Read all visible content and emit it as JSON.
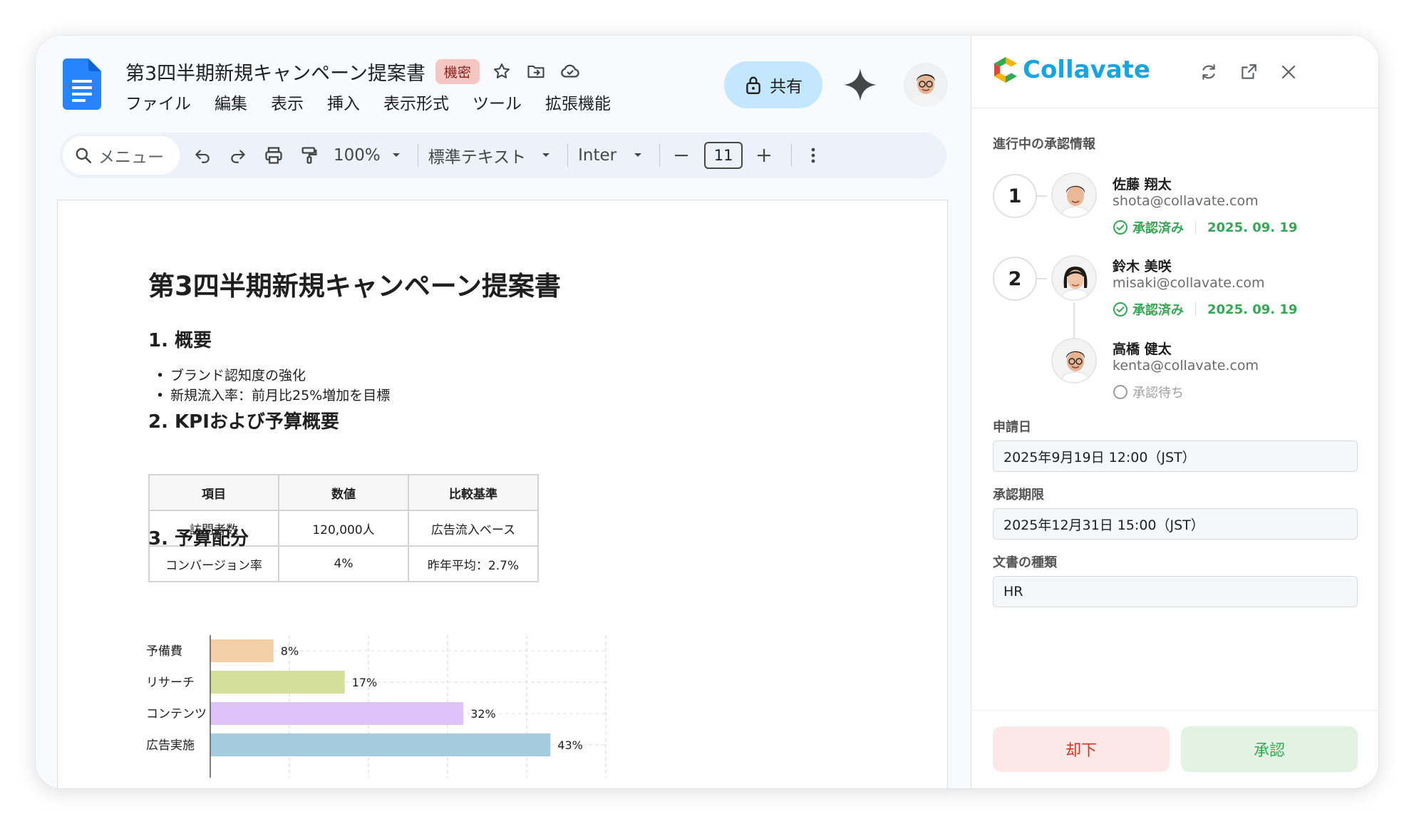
{
  "docs": {
    "title": "第3四半期新規キャンペーン提案書",
    "badge": "機密",
    "menu": [
      "ファイル",
      "編集",
      "表示",
      "挿入",
      "表示形式",
      "ツール",
      "拡張機能"
    ],
    "share_label": "共有",
    "toolbar": {
      "search_placeholder": "メニュー",
      "zoom": "100%",
      "style": "標準テキスト",
      "font": "Inter",
      "font_size": "11"
    }
  },
  "document": {
    "heading": "第3四半期新規キャンペーン提案書",
    "section1_title": "1. 概要",
    "bullets": [
      "ブランド認知度の強化",
      "新規流入率：前月比25%増加を目標"
    ],
    "section2_title": "2. KPIおよび予算概要",
    "table": {
      "headers": [
        "項目",
        "数値",
        "比較基準"
      ],
      "rows": [
        [
          "訪問者数",
          "120,000人",
          "広告流入ベース"
        ],
        [
          "コンバージョン率",
          "4%",
          "昨年平均：2.7%"
        ]
      ]
    },
    "section3_title": "3. 予算配分"
  },
  "chart_data": {
    "type": "bar",
    "orientation": "horizontal",
    "categories": [
      "予備費",
      "リサーチ",
      "コンテンツ",
      "広告実施"
    ],
    "values": [
      8,
      17,
      32,
      43
    ],
    "value_labels": [
      "8%",
      "17%",
      "32%",
      "43%"
    ],
    "colors": [
      "#f2cfa6",
      "#d3df9b",
      "#dec3fb",
      "#a4cbe0"
    ],
    "xlim": [
      0,
      50
    ],
    "grid": true
  },
  "panel": {
    "brand": "Collavate",
    "approval_section_label": "進行中の承認情報",
    "steps": [
      {
        "number": "1",
        "approvers": [
          {
            "name": "佐藤 翔太",
            "email": "shota@collavate.com",
            "status": "承認済み",
            "date": "2025. 09. 19"
          }
        ]
      },
      {
        "number": "2",
        "approvers": [
          {
            "name": "鈴木 美咲",
            "email": "misaki@collavate.com",
            "status": "承認済み",
            "date": "2025. 09. 19"
          },
          {
            "name": "高橋 健太",
            "email": "kenta@collavate.com",
            "status": "承認待ち",
            "date": ""
          }
        ]
      }
    ],
    "request_date_label": "申請日",
    "request_date": "2025年9月19日 12:00（JST）",
    "deadline_label": "承認期限",
    "deadline": "2025年12月31日 15:00（JST）",
    "doc_type_label": "文書の種類",
    "doc_type": "HR",
    "reject_label": "却下",
    "approve_label": "承認"
  },
  "colors": {
    "docs_blue": "#4285f4",
    "share_bg": "#c2e7ff",
    "brand_blue": "#17a4e3",
    "approved_green": "#34a853",
    "reject_red": "#d93025"
  }
}
